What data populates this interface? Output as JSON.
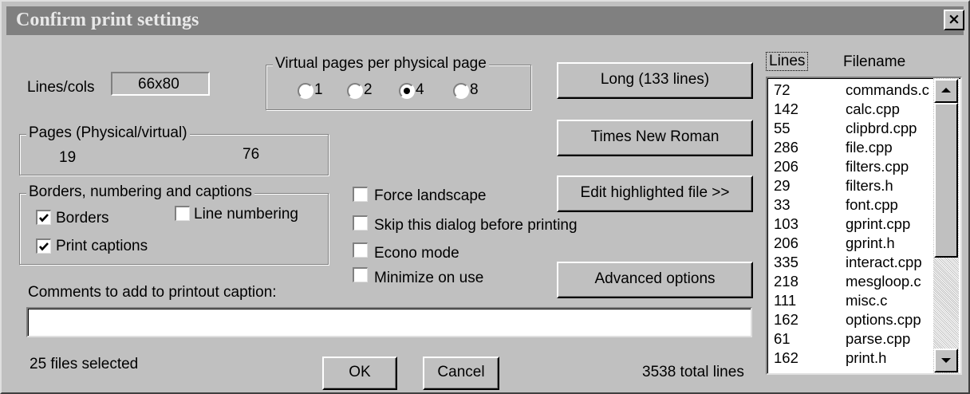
{
  "window": {
    "title": "Confirm print settings",
    "close_glyph": "×"
  },
  "lines_cols": {
    "label": "Lines/cols",
    "value": "66x80"
  },
  "virtual_pages": {
    "title": "Virtual pages per physical page",
    "options": [
      "1",
      "2",
      "4",
      "8"
    ],
    "selected": "4"
  },
  "pages": {
    "title": "Pages (Physical/virtual)",
    "physical": "19",
    "virtual": "76"
  },
  "borders_group": {
    "title": "Borders, numbering and captions",
    "borders": {
      "label": "Borders",
      "checked": true
    },
    "line_numbering": {
      "label": "Line numbering",
      "checked": false
    },
    "print_captions": {
      "label": "Print captions",
      "checked": true
    }
  },
  "options": {
    "force_landscape": {
      "label": "Force landscape",
      "checked": false
    },
    "skip_dialog": {
      "label": "Skip this dialog before printing",
      "checked": false
    },
    "econo_mode": {
      "label": "Econo mode",
      "checked": false
    },
    "minimize_on_use": {
      "label": "Minimize on use",
      "checked": false
    }
  },
  "buttons": {
    "long": "Long (133 lines)",
    "font": "Times New Roman",
    "edit": "Edit highlighted file >>",
    "advanced": "Advanced options",
    "ok": "OK",
    "cancel": "Cancel"
  },
  "comments": {
    "label": "Comments to add to printout caption:",
    "value": ""
  },
  "status": {
    "files_selected": "25 files selected",
    "total_lines": "3538 total lines"
  },
  "file_list": {
    "headers": {
      "lines": "Lines",
      "filename": "Filename"
    },
    "rows": [
      {
        "lines": "72",
        "filename": "commands.c"
      },
      {
        "lines": "142",
        "filename": "calc.cpp"
      },
      {
        "lines": "55",
        "filename": "clipbrd.cpp"
      },
      {
        "lines": "286",
        "filename": "file.cpp"
      },
      {
        "lines": "206",
        "filename": "filters.cpp"
      },
      {
        "lines": "29",
        "filename": "filters.h"
      },
      {
        "lines": "33",
        "filename": "font.cpp"
      },
      {
        "lines": "103",
        "filename": "gprint.cpp"
      },
      {
        "lines": "206",
        "filename": "gprint.h"
      },
      {
        "lines": "335",
        "filename": "interact.cpp"
      },
      {
        "lines": "218",
        "filename": "mesgloop.c"
      },
      {
        "lines": "111",
        "filename": "misc.c"
      },
      {
        "lines": "162",
        "filename": "options.cpp"
      },
      {
        "lines": "61",
        "filename": "parse.cpp"
      },
      {
        "lines": "162",
        "filename": "print.h"
      }
    ]
  },
  "icons": {
    "scroll_up": "triangle-up-icon",
    "scroll_down": "triangle-down-icon"
  }
}
